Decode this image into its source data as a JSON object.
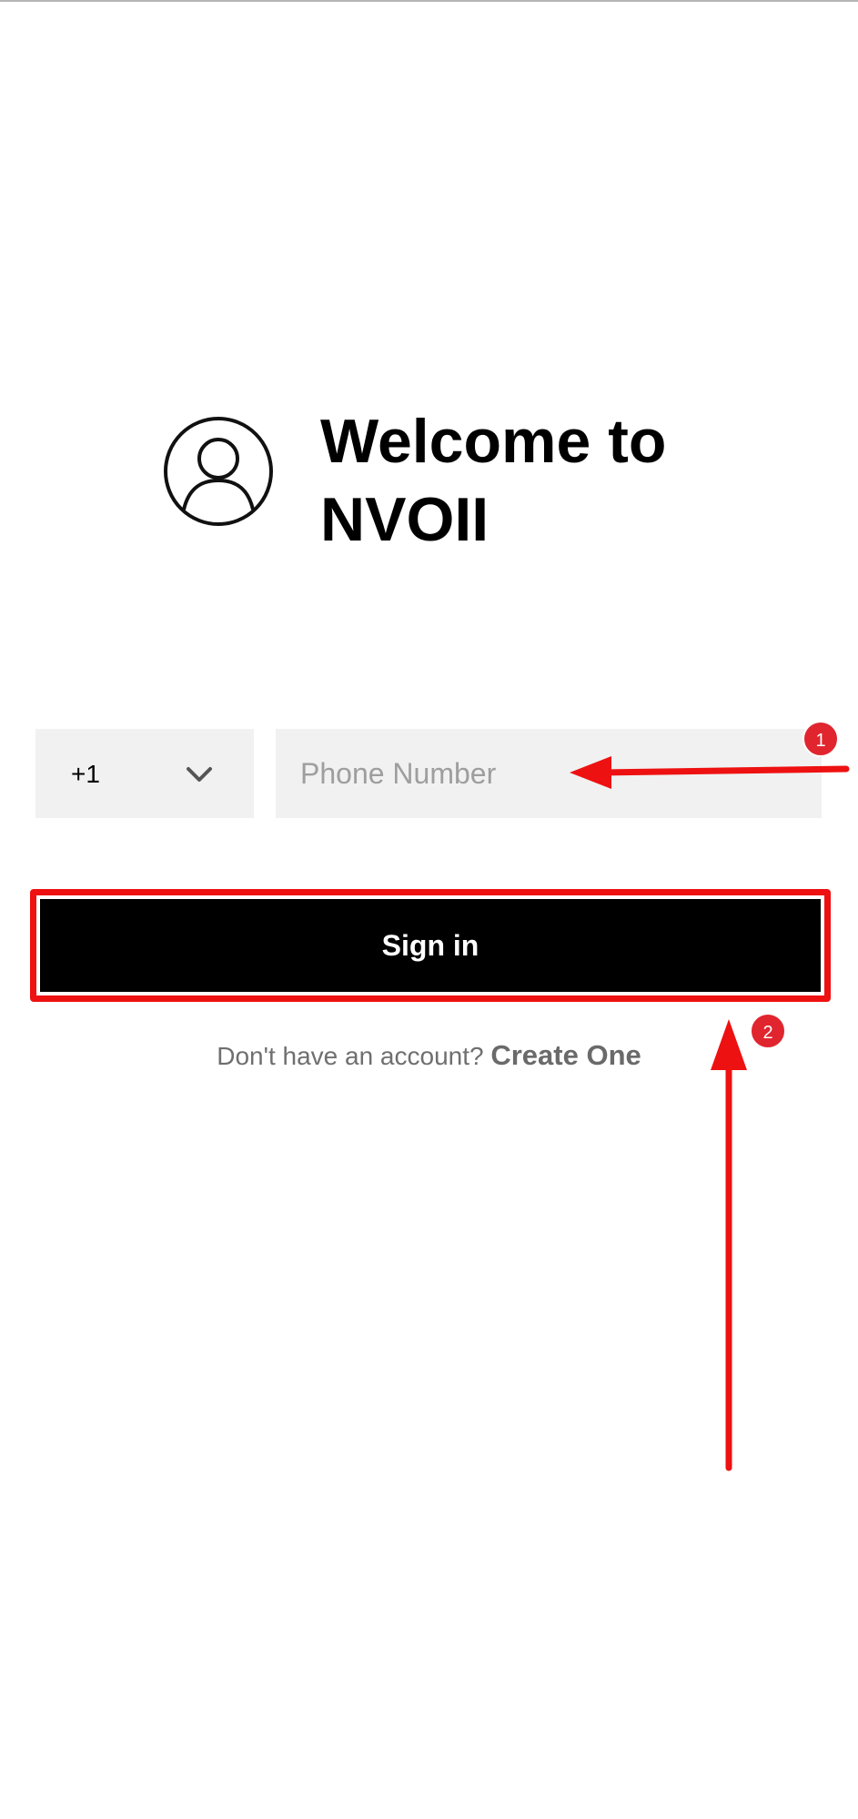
{
  "header": {
    "avatar_icon": "user-circle-icon",
    "title_line1": "Welcome to",
    "title_line2": "NVOII"
  },
  "form": {
    "country_code": "+1",
    "country_chevron_icon": "chevron-down-icon",
    "phone_placeholder": "Phone Number",
    "phone_value": ""
  },
  "signin": {
    "label": "Sign in"
  },
  "signup": {
    "prompt": "Don't have an account?",
    "link_label": "Create One"
  },
  "annotations": {
    "step1_label": "1",
    "step2_label": "2",
    "highlight_color": "#ee1111",
    "badge_color": "#e0252f"
  }
}
